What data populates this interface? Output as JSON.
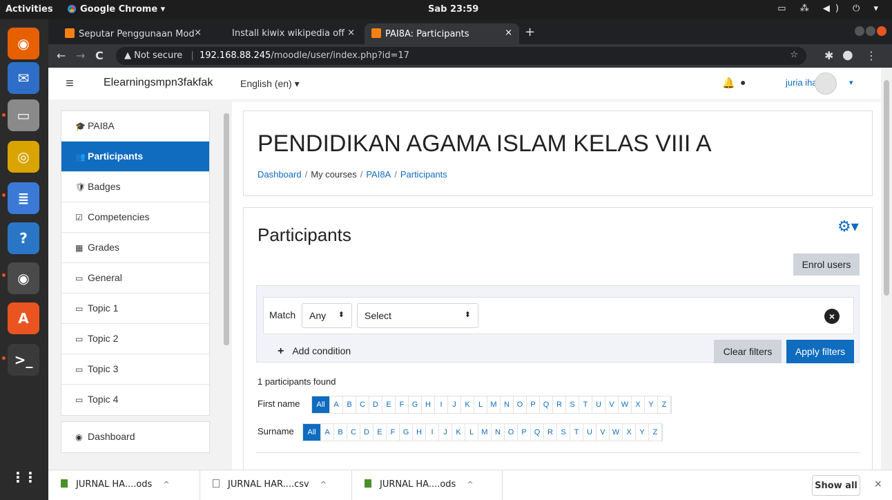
{
  "topbar": {
    "activities": "Activities",
    "app_name": "Google Chrome ▾",
    "clock": "Sab 23:59",
    "tray": "▭ ⁂ ◀) ⏻ ▾"
  },
  "dock": {
    "items": [
      {
        "name": "firefox-icon",
        "glyph": "◉",
        "color": "#e66000"
      },
      {
        "name": "thunderbird-icon",
        "glyph": "✉",
        "color": "#2f6ec6"
      },
      {
        "name": "files-icon",
        "glyph": "▭",
        "color": "#8a8a8a"
      },
      {
        "name": "rhythmbox-icon",
        "glyph": "◎",
        "color": "#d9a400"
      },
      {
        "name": "libreoffice-writer-icon",
        "glyph": "≣",
        "color": "#3a7ad6"
      },
      {
        "name": "help-icon",
        "glyph": "?",
        "color": "#2a76c6"
      },
      {
        "name": "chrome-icon",
        "glyph": "◉",
        "color": "#4a4a4a"
      },
      {
        "name": "software-center-icon",
        "glyph": "A",
        "color": "#e95420"
      },
      {
        "name": "terminal-icon",
        "glyph": ">_",
        "color": "#3a3a3a"
      }
    ],
    "apps_grid": "⋮⋮"
  },
  "browser": {
    "tabs": [
      {
        "title": "Seputar Penggunaan Mod",
        "close": "×"
      },
      {
        "title": "Install kiwix wikipedia off",
        "close": "×"
      },
      {
        "title": "PAI8A: Participants",
        "close": "×"
      }
    ],
    "new_tab": "+",
    "back": "←",
    "forward": "→",
    "reload": "C",
    "not_secure": "▲ Not secure",
    "separator": "|",
    "url_host": "192.168.88.245",
    "url_path": "/moodle/user/index.php?id=17",
    "star": "☆",
    "extensions": "✱",
    "profile": "●",
    "menu": "⋮"
  },
  "moodle": {
    "menu_toggle": "≡",
    "site_name": "Elearningsmpn3fakfak",
    "language": "English (en) ▾",
    "bell": "🔔",
    "chat": "●",
    "user_name": "juria iha",
    "user_caret": "▾",
    "nav": [
      {
        "icon": "🎓",
        "label": "PAI8A",
        "active": false,
        "name": "nav-course-pai8a"
      },
      {
        "icon": "👥",
        "label": "Participants",
        "active": true,
        "name": "nav-participants"
      },
      {
        "icon": "🛡",
        "label": "Badges",
        "active": false,
        "name": "nav-badges"
      },
      {
        "icon": "☑",
        "label": "Competencies",
        "active": false,
        "name": "nav-competencies"
      },
      {
        "icon": "▦",
        "label": "Grades",
        "active": false,
        "name": "nav-grades"
      },
      {
        "icon": "▭",
        "label": "General",
        "active": false,
        "name": "nav-general"
      },
      {
        "icon": "▭",
        "label": "Topic 1",
        "active": false,
        "name": "nav-topic-1"
      },
      {
        "icon": "▭",
        "label": "Topic 2",
        "active": false,
        "name": "nav-topic-2"
      },
      {
        "icon": "▭",
        "label": "Topic 3",
        "active": false,
        "name": "nav-topic-3"
      },
      {
        "icon": "▭",
        "label": "Topic 4",
        "active": false,
        "name": "nav-topic-4"
      }
    ],
    "nav2": [
      {
        "icon": "◉",
        "label": "Dashboard",
        "name": "nav-dashboard"
      }
    ],
    "course_title": "PENDIDIKAN AGAMA ISLAM KELAS VIII A",
    "breadcrumb": [
      "Dashboard",
      "My courses",
      "PAI8A",
      "Participants"
    ],
    "breadcrumb_sep": "/",
    "page_title": "Participants",
    "gear": "⚙▾",
    "enrol_button": "Enrol users",
    "filter": {
      "match_label": "Match",
      "match_value": "Any",
      "type_value": "Select",
      "arrow": "⬍",
      "remove": "×",
      "add_condition": "Add condition",
      "add_plus": "+",
      "clear": "Clear filters",
      "apply": "Apply filters"
    },
    "found": "1 participants found",
    "first_name_label": "First name",
    "surname_label": "Surname",
    "letters": [
      "All",
      "A",
      "B",
      "C",
      "D",
      "E",
      "F",
      "G",
      "H",
      "I",
      "J",
      "K",
      "L",
      "M",
      "N",
      "O",
      "P",
      "Q",
      "R",
      "S",
      "T",
      "U",
      "V",
      "W",
      "X",
      "Y",
      "Z"
    ]
  },
  "downloads": {
    "items": [
      {
        "name": "JURNAL HA....ods",
        "type": "ods"
      },
      {
        "name": "JURNAL HAR....csv",
        "type": "csv"
      },
      {
        "name": "JURNAL HA....ods",
        "type": "ods"
      }
    ],
    "caret": "^",
    "show_all": "Show all",
    "close": "×"
  }
}
